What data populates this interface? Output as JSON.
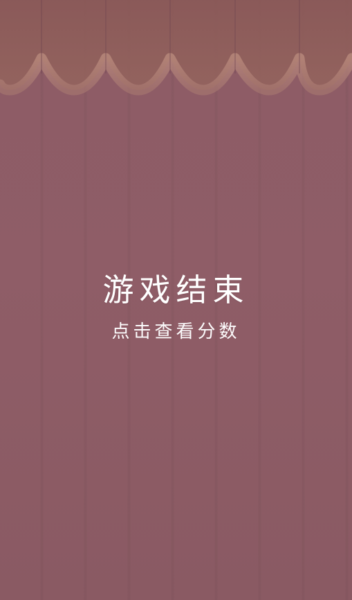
{
  "screen": {
    "title": "游戏结束",
    "subtitle": "点击查看分数"
  },
  "colors": {
    "background": "#8e5d66",
    "curtain_top": "#8f5f5b",
    "curtain_trim": "#b98a80",
    "text": "#ffffff"
  },
  "icons": {
    "curtain": "scalloped-curtain-valance"
  }
}
